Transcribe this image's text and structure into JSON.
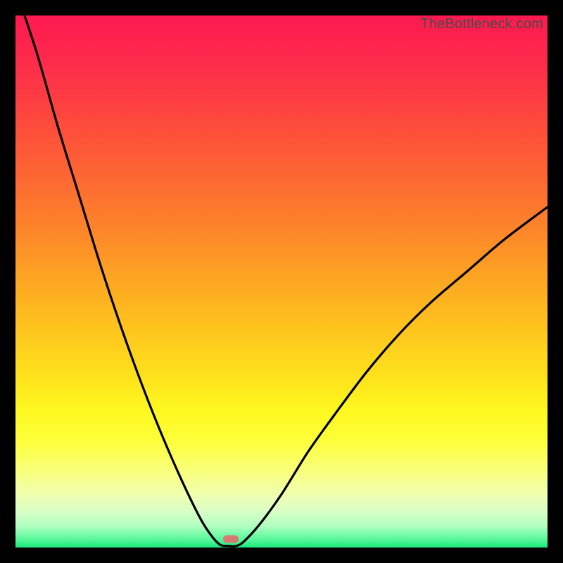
{
  "watermark": "TheBottleneck.com",
  "gradient_stops": [
    {
      "offset": 0.0,
      "color": "#fd1950"
    },
    {
      "offset": 0.1,
      "color": "#fd2e4a"
    },
    {
      "offset": 0.2,
      "color": "#fd4a3d"
    },
    {
      "offset": 0.3,
      "color": "#fd6633"
    },
    {
      "offset": 0.4,
      "color": "#fd842a"
    },
    {
      "offset": 0.5,
      "color": "#fda722"
    },
    {
      "offset": 0.6,
      "color": "#fec81e"
    },
    {
      "offset": 0.68,
      "color": "#fee21c"
    },
    {
      "offset": 0.74,
      "color": "#fef820"
    },
    {
      "offset": 0.8,
      "color": "#feff3a"
    },
    {
      "offset": 0.86,
      "color": "#f8ff80"
    },
    {
      "offset": 0.9,
      "color": "#f0ffb0"
    },
    {
      "offset": 0.93,
      "color": "#dcffc5"
    },
    {
      "offset": 0.96,
      "color": "#b0ffc0"
    },
    {
      "offset": 0.985,
      "color": "#56f89b"
    },
    {
      "offset": 1.0,
      "color": "#1ae778"
    }
  ],
  "marker": {
    "x_pct": 40.5,
    "y_pct": 98.4,
    "color": "#d87a74"
  },
  "chart_data": {
    "type": "line",
    "title": "",
    "xlabel": "",
    "ylabel": "",
    "xlim": [
      0,
      100
    ],
    "ylim": [
      0,
      100
    ],
    "series": [
      {
        "name": "bottleneck-curve",
        "x": [
          0,
          4,
          8,
          12,
          16,
          20,
          24,
          28,
          32,
          35,
          37,
          38.5,
          40,
          41.5,
          43,
          46,
          50,
          55,
          60,
          66,
          72,
          78,
          85,
          92,
          100
        ],
        "y": [
          105,
          93,
          79,
          66,
          53,
          41,
          30,
          20,
          11,
          5,
          2,
          0.5,
          0.3,
          0.3,
          1.2,
          4.5,
          10,
          18,
          25,
          33,
          40,
          46,
          52,
          58,
          64
        ]
      }
    ],
    "annotations": [
      {
        "type": "marker",
        "x": 40.5,
        "y": 1.6
      }
    ]
  }
}
